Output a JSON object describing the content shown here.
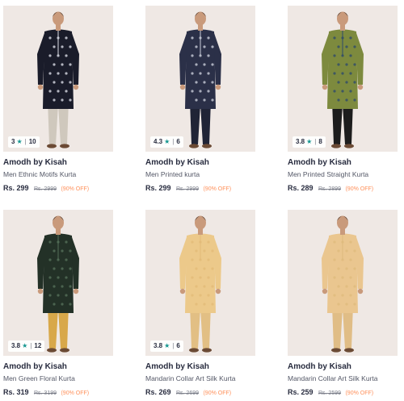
{
  "products": [
    {
      "rating": "3",
      "rating_count": "10",
      "brand": "Amodh by Kisah",
      "name": "Men Ethnic Motifs Kurta",
      "price": "Rs. 299",
      "mrp": "Rs. 2999",
      "discount": "(90% OFF)",
      "kurta_color": "#1a1c2a",
      "print_color": "#d9dce6",
      "pant_color": "#cfc8bd",
      "bg_color": "#efe8e4"
    },
    {
      "rating": "4.3",
      "rating_count": "6",
      "brand": "Amodh by Kisah",
      "name": "Men Printed kurta",
      "price": "Rs. 299",
      "mrp": "Rs. 2999",
      "discount": "(90% OFF)",
      "kurta_color": "#2b3048",
      "print_color": "#c9cdd8",
      "pant_color": "#202436",
      "bg_color": "#efe8e4"
    },
    {
      "rating": "3.8",
      "rating_count": "8",
      "brand": "Amodh by Kisah",
      "name": "Men Printed Straight Kurta",
      "price": "Rs. 289",
      "mrp": "Rs. 2899",
      "discount": "(90% OFF)",
      "kurta_color": "#7d8a3e",
      "print_color": "#2f4a6a",
      "pant_color": "#1d1d1d",
      "bg_color": "#efe8e4"
    },
    {
      "rating": "3.8",
      "rating_count": "12",
      "brand": "Amodh by Kisah",
      "name": "Men Green Floral Kurta",
      "price": "Rs. 319",
      "mrp": "Rs. 3199",
      "discount": "(90% OFF)",
      "kurta_color": "#233127",
      "print_color": "#55705a",
      "pant_color": "#d8a84a",
      "bg_color": "#efe8e4"
    },
    {
      "rating": "3.8",
      "rating_count": "6",
      "brand": "Amodh by Kisah",
      "name": "Mandarin Collar Art Silk Kurta",
      "price": "Rs. 269",
      "mrp": "Rs. 2699",
      "discount": "(90% OFF)",
      "kurta_color": "#ecc98a",
      "print_color": "#e2bb78",
      "pant_color": "#e2bf84",
      "bg_color": "#efe8e4"
    },
    {
      "rating": "",
      "rating_count": "",
      "brand": "Amodh by Kisah",
      "name": "Mandarin Collar Art Silk Kurta",
      "price": "Rs. 259",
      "mrp": "Rs. 2599",
      "discount": "(90% OFF)",
      "kurta_color": "#eac68f",
      "print_color": "#dfba7d",
      "pant_color": "#e0bd86",
      "bg_color": "#efe8e4"
    }
  ]
}
